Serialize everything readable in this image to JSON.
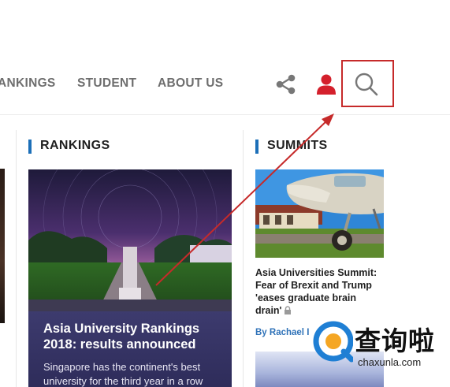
{
  "nav": {
    "items": [
      "ANKINGS",
      "STUDENT",
      "ABOUT US"
    ]
  },
  "icons": {
    "share": "share-icon",
    "account": "user-icon",
    "search": "search-icon"
  },
  "colors": {
    "accent_red": "#c62a2a",
    "section_bar_blue": "#1c6fb8",
    "card_overlay": "#3d3b6e",
    "byline_blue": "#2f72b8"
  },
  "rankings": {
    "title": "RANKINGS",
    "card": {
      "headline": "Asia University Rankings 2018: results announced",
      "subtext": "Singapore has the continent's best university for the third year in a row"
    }
  },
  "summits": {
    "title": "SUMMITS",
    "article": {
      "headline": "Asia Universities Summit: Fear of Brexit and Trump 'eases graduate brain drain'",
      "byline": "By Rachael I"
    }
  },
  "watermark": {
    "text_cn": "查询啦",
    "text_en": "chaxunla.com"
  }
}
